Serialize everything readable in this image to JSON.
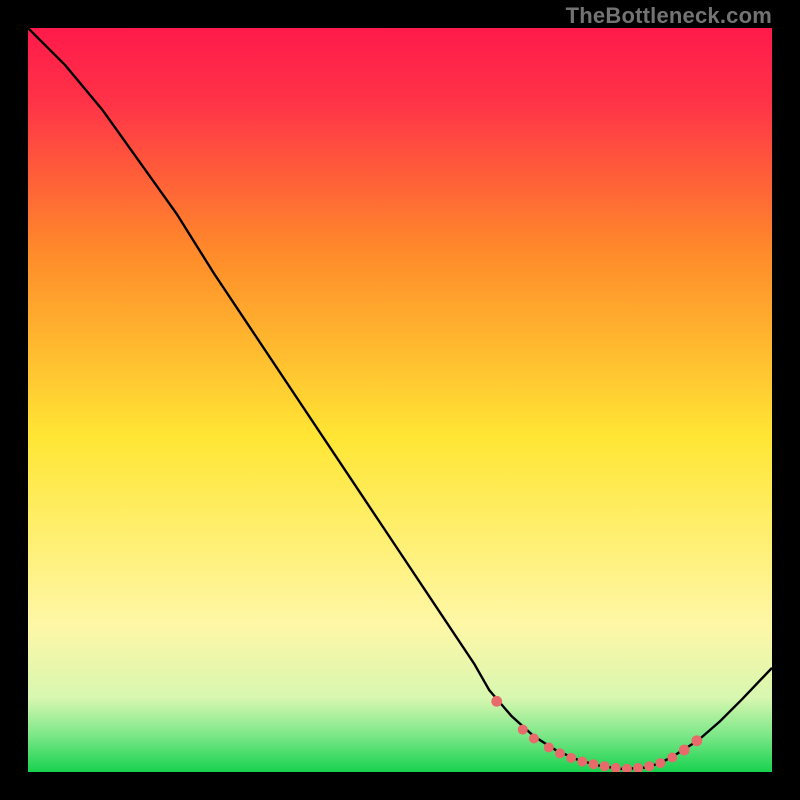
{
  "watermark": "TheBottleneck.com",
  "colors": {
    "frame": "#000000",
    "curve": "#000000",
    "dots": "#e86a6a",
    "grad_top": "#ff1a4a",
    "grad_orange": "#ff8a2a",
    "grad_yellow": "#ffe634",
    "grad_paleyellow": "#fff7a6",
    "grad_palegreen": "#a9f2b0",
    "grad_green": "#17d24e"
  },
  "chart_data": {
    "type": "line",
    "title": "",
    "xlabel": "",
    "ylabel": "",
    "xlim": [
      0,
      100
    ],
    "ylim": [
      0,
      100
    ],
    "series": [
      {
        "name": "bottleneck-curve",
        "x": [
          0,
          5,
          10,
          15,
          20,
          25,
          30,
          35,
          40,
          45,
          50,
          55,
          60,
          62,
          65,
          68,
          71,
          74,
          77,
          80,
          83,
          85,
          87,
          90,
          93,
          96,
          100
        ],
        "y": [
          100,
          95,
          89,
          82,
          75,
          67,
          59.5,
          52,
          44.5,
          37,
          29.5,
          22,
          14.5,
          11,
          7.5,
          4.8,
          2.9,
          1.6,
          0.8,
          0.4,
          0.6,
          1.2,
          2.3,
          4.2,
          6.8,
          9.8,
          14
        ]
      }
    ],
    "highlight_points": {
      "name": "optimal-band-dots",
      "x": [
        63,
        66.5,
        68,
        70,
        71.5,
        73,
        74.5,
        76,
        77.5,
        79,
        80.5,
        82,
        83.5,
        85,
        86.6,
        88.2,
        89.9
      ],
      "y": [
        9.5,
        5.7,
        4.5,
        3.3,
        2.5,
        1.9,
        1.4,
        1.05,
        0.78,
        0.55,
        0.44,
        0.55,
        0.78,
        1.2,
        1.95,
        2.95,
        4.2
      ]
    },
    "gradient_stops": [
      {
        "offset": 0.0,
        "color": "#ff1a4a"
      },
      {
        "offset": 0.1,
        "color": "#ff3348"
      },
      {
        "offset": 0.3,
        "color": "#ff8a2a"
      },
      {
        "offset": 0.55,
        "color": "#ffe634"
      },
      {
        "offset": 0.8,
        "color": "#fff7a6"
      },
      {
        "offset": 0.9,
        "color": "#d8f7b0"
      },
      {
        "offset": 0.95,
        "color": "#7de889"
      },
      {
        "offset": 1.0,
        "color": "#17d24e"
      }
    ]
  }
}
